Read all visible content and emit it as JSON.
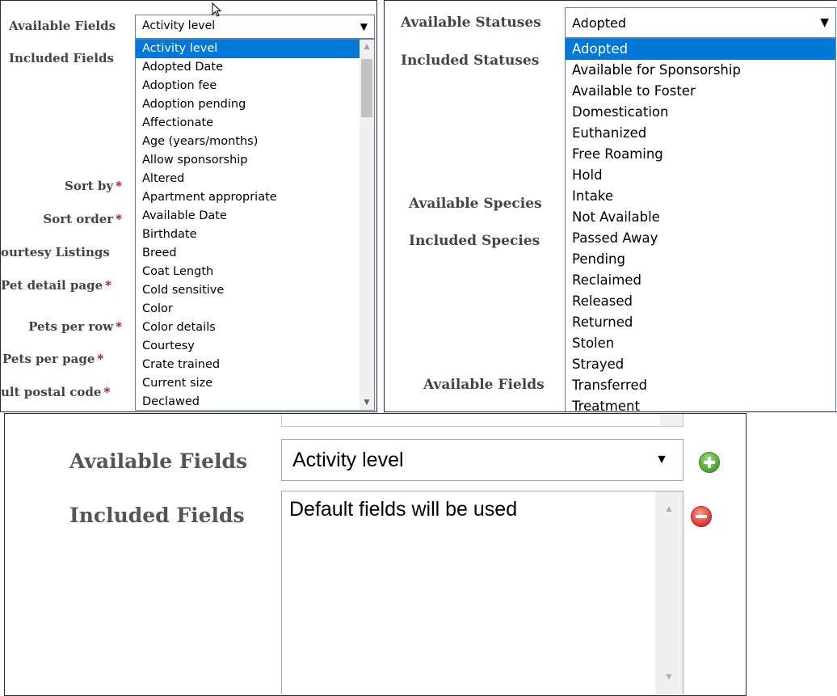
{
  "panel1": {
    "labels": {
      "available_fields": "Available Fields",
      "included_fields": "Included Fields",
      "sort_by": "Sort by",
      "sort_order": "Sort order",
      "courtesy_listings": "ourtesy Listings",
      "pet_detail_page": "Pet detail page",
      "pets_per_row": "Pets per row",
      "pets_per_page": "Pets per page",
      "default_postal_code": "ult postal code"
    },
    "required_mark": "*",
    "select_value": "Activity level",
    "options": [
      "Activity level",
      "Adopted Date",
      "Adoption fee",
      "Adoption pending",
      "Affectionate",
      "Age (years/months)",
      "Allow sponsorship",
      "Altered",
      "Apartment appropriate",
      "Available Date",
      "Birthdate",
      "Breed",
      "Coat Length",
      "Cold sensitive",
      "Color",
      "Color details",
      "Courtesy",
      "Crate trained",
      "Current size",
      "Declawed"
    ],
    "highlighted_index": 0
  },
  "panel2": {
    "labels": {
      "available_statuses": "Available Statuses",
      "included_statuses": "Included Statuses",
      "available_species": "Available Species",
      "included_species": "Included Species",
      "available_fields": "Available Fields"
    },
    "select_value": "Adopted",
    "options": [
      "Adopted",
      "Available for Sponsorship",
      "Available to Foster",
      "Domestication",
      "Euthanized",
      "Free Roaming",
      "Hold",
      "Intake",
      "Not Available",
      "Passed Away",
      "Pending",
      "Reclaimed",
      "Released",
      "Returned",
      "Stolen",
      "Strayed",
      "Transferred",
      "Treatment"
    ],
    "highlighted_index": 0
  },
  "panel3": {
    "available_fields_label": "Available Fields",
    "included_fields_label": "Included Fields",
    "select_value": "Activity level",
    "included_value": "Default fields will be used",
    "add_icon": "plus-circle-green",
    "remove_icon": "minus-circle-red"
  },
  "colors": {
    "highlight": "#0078d7",
    "required": "#c00000",
    "label": "#444444",
    "add_green": "#5cb13b",
    "remove_red": "#e0413c"
  }
}
